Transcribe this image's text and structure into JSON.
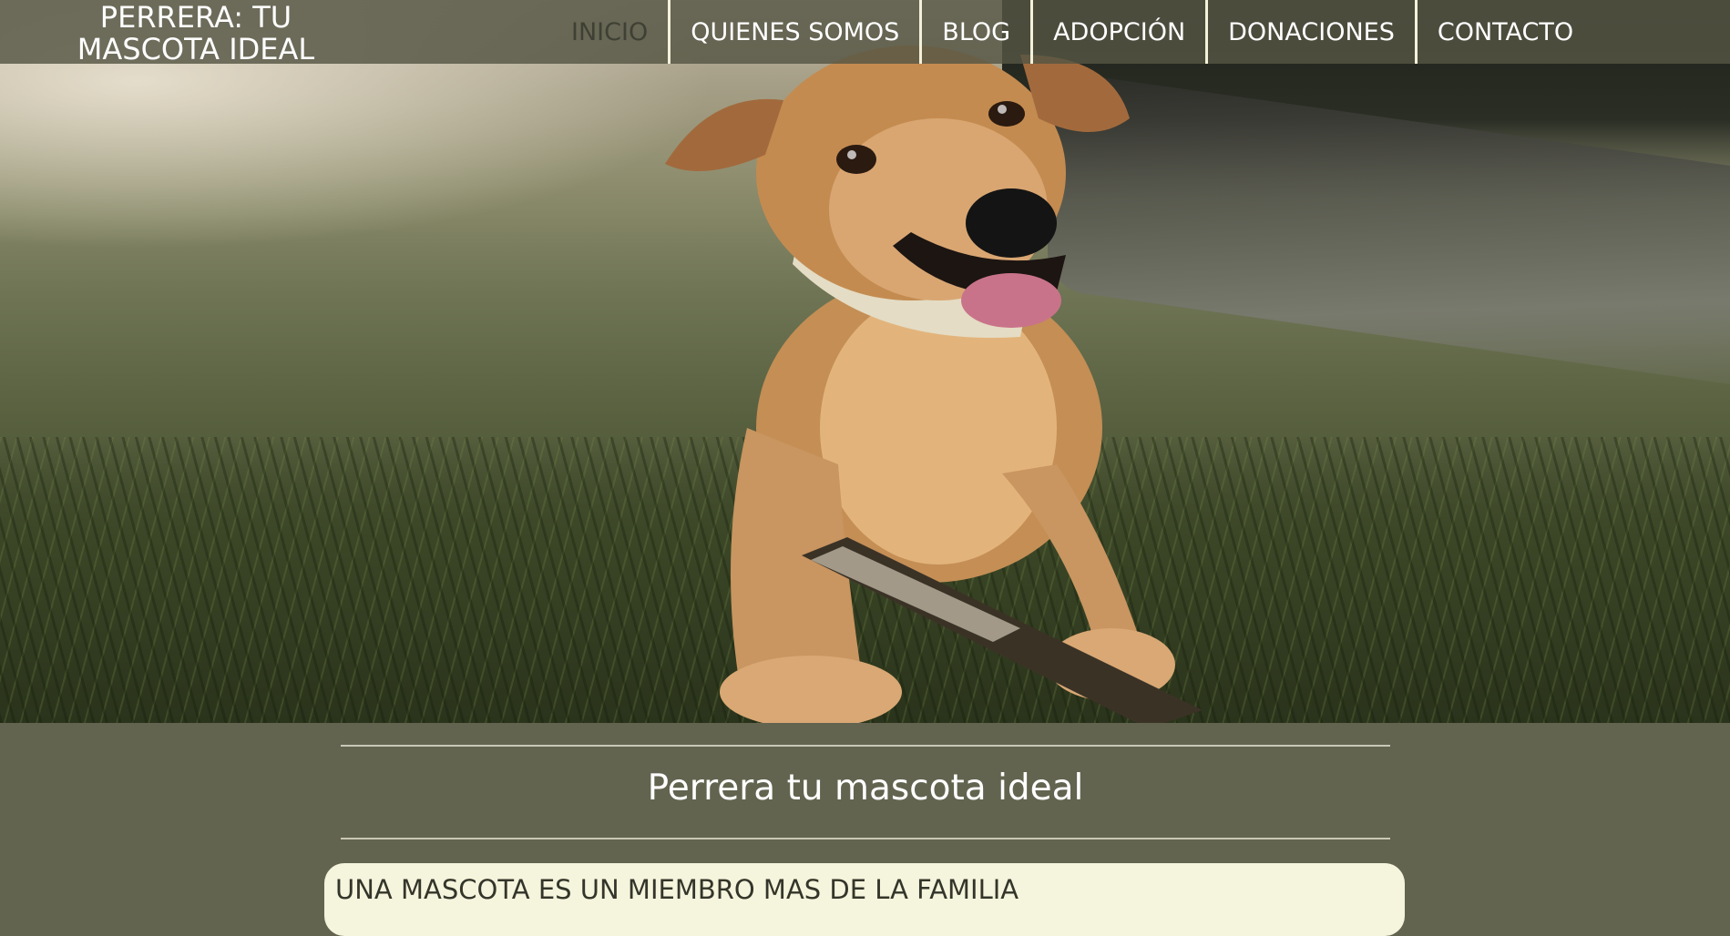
{
  "site": {
    "brand_line1": "PERRERA: TU",
    "brand_line2": "MASCOTA IDEAL"
  },
  "nav": {
    "items": [
      {
        "label": "INICIO",
        "active": true
      },
      {
        "label": "QUIENES SOMOS",
        "active": false
      },
      {
        "label": "BLOG",
        "active": false
      },
      {
        "label": "ADOPCIÓN",
        "active": false
      },
      {
        "label": "DONACIONES",
        "active": false
      },
      {
        "label": "CONTACTO",
        "active": false
      }
    ]
  },
  "intro": {
    "title": "Perrera tu mascota ideal",
    "card_heading": "UNA MASCOTA ES UN MIEMBRO MAS DE LA FAMILIA"
  },
  "colors": {
    "page_background": "#626450",
    "header_background": "#555644",
    "nav_divider": "#f3f1da",
    "nav_active_text": "#3f4034",
    "card_background": "#f5f4dc"
  },
  "icons": {
    "hero_image": "dog-lying-on-grass-with-stick"
  }
}
